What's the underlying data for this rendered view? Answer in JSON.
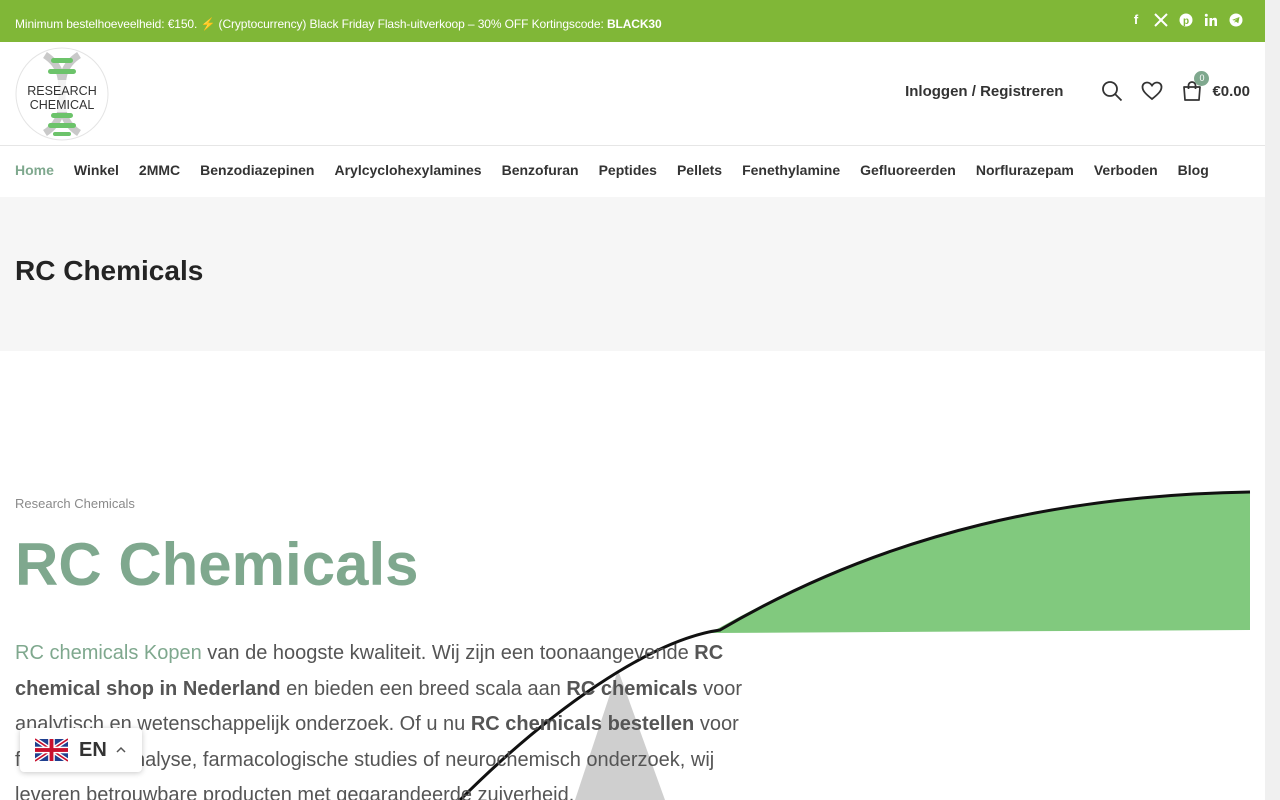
{
  "topbar": {
    "message_prefix": "Minimum bestelhoeveelheid: €150. ⚡ (Cryptocurrency) Black Friday Flash-uitverkoop – 30% OFF Kortingscode: ",
    "coupon_code": "BLACK30",
    "background": "#80b737",
    "social_icons": [
      "facebook-icon",
      "x-icon",
      "pinterest-icon",
      "linkedin-icon",
      "telegram-icon"
    ]
  },
  "header": {
    "logo_line1": "RESEARCH",
    "logo_line2": "CHEMICAL",
    "login_label": "Inloggen / Registreren",
    "cart_count": "0",
    "cart_total": "€0.00"
  },
  "nav": {
    "items": [
      {
        "label": "Home",
        "active": true
      },
      {
        "label": "Winkel"
      },
      {
        "label": "2MMC"
      },
      {
        "label": "Benzodiazepinen"
      },
      {
        "label": "Arylcyclohexylamines"
      },
      {
        "label": "Benzofuran"
      },
      {
        "label": "Peptides"
      },
      {
        "label": "Pellets"
      },
      {
        "label": "Fenethylamine"
      },
      {
        "label": "Gefluoreerden"
      },
      {
        "label": "Norflurazepam"
      },
      {
        "label": "Verboden"
      },
      {
        "label": "Blog"
      }
    ]
  },
  "page_title": "RC Chemicals",
  "content": {
    "eyebrow": "Research Chemicals",
    "hero_title": "RC Chemicals",
    "intro": {
      "link_text": "RC chemicals Kopen",
      "t1": " van de hoogste kwaliteit. Wij zijn een toonaangevende ",
      "b1": "RC chemical shop in Nederland",
      "t2": " en bieden een breed scala aan ",
      "b2": "RC chemicals",
      "t3": " voor analytisch en wetenschappelijk onderzoek. Of u nu ",
      "b3": "RC chemicals bestellen",
      "t4": " voor forensische analyse, farmacologische studies of neurochemisch onderzoek, wij leveren betrouwbare producten met gegarandeerde zuiverheid."
    }
  },
  "language": {
    "code": "EN",
    "flag_icon": "uk-flag-icon"
  },
  "colors": {
    "accent": "#7fa88e",
    "topbar": "#80b737",
    "decor_green": "#81c97e"
  }
}
